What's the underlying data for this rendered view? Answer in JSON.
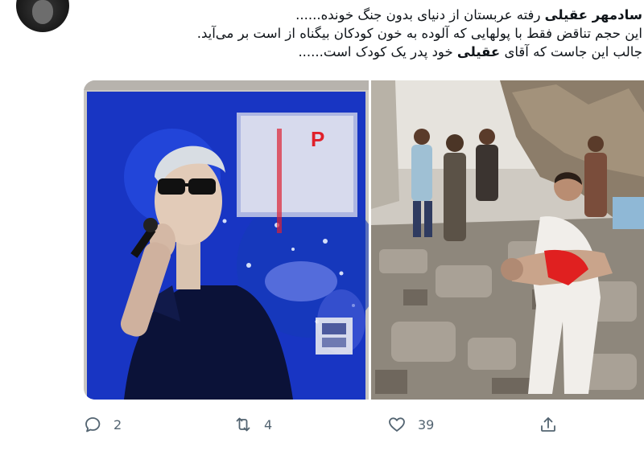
{
  "tweet": {
    "author_name": "سادمهر عقیلی",
    "text_line1_rest": " رفته عربستان از دنیای بدون جنگ خونده......",
    "text_line2": "این حجم تناقض فقط با پولهایی که آلوده به خون کودکان بیگناه از است بر می‌آید.",
    "text_line3_prefix": "جالب این جاست که آقای ",
    "text_line3_name": "عقیلی",
    "text_line3_suffix": " خود پدر یک کودک است......",
    "image_left_overlay": "P"
  },
  "actions": {
    "reply_count": "2",
    "retweet_count": "4",
    "like_count": "39"
  },
  "colors": {
    "icon_gray": "#536471",
    "concert_blue": "#1b3fd1",
    "rubble_gray": "#9b958c"
  }
}
